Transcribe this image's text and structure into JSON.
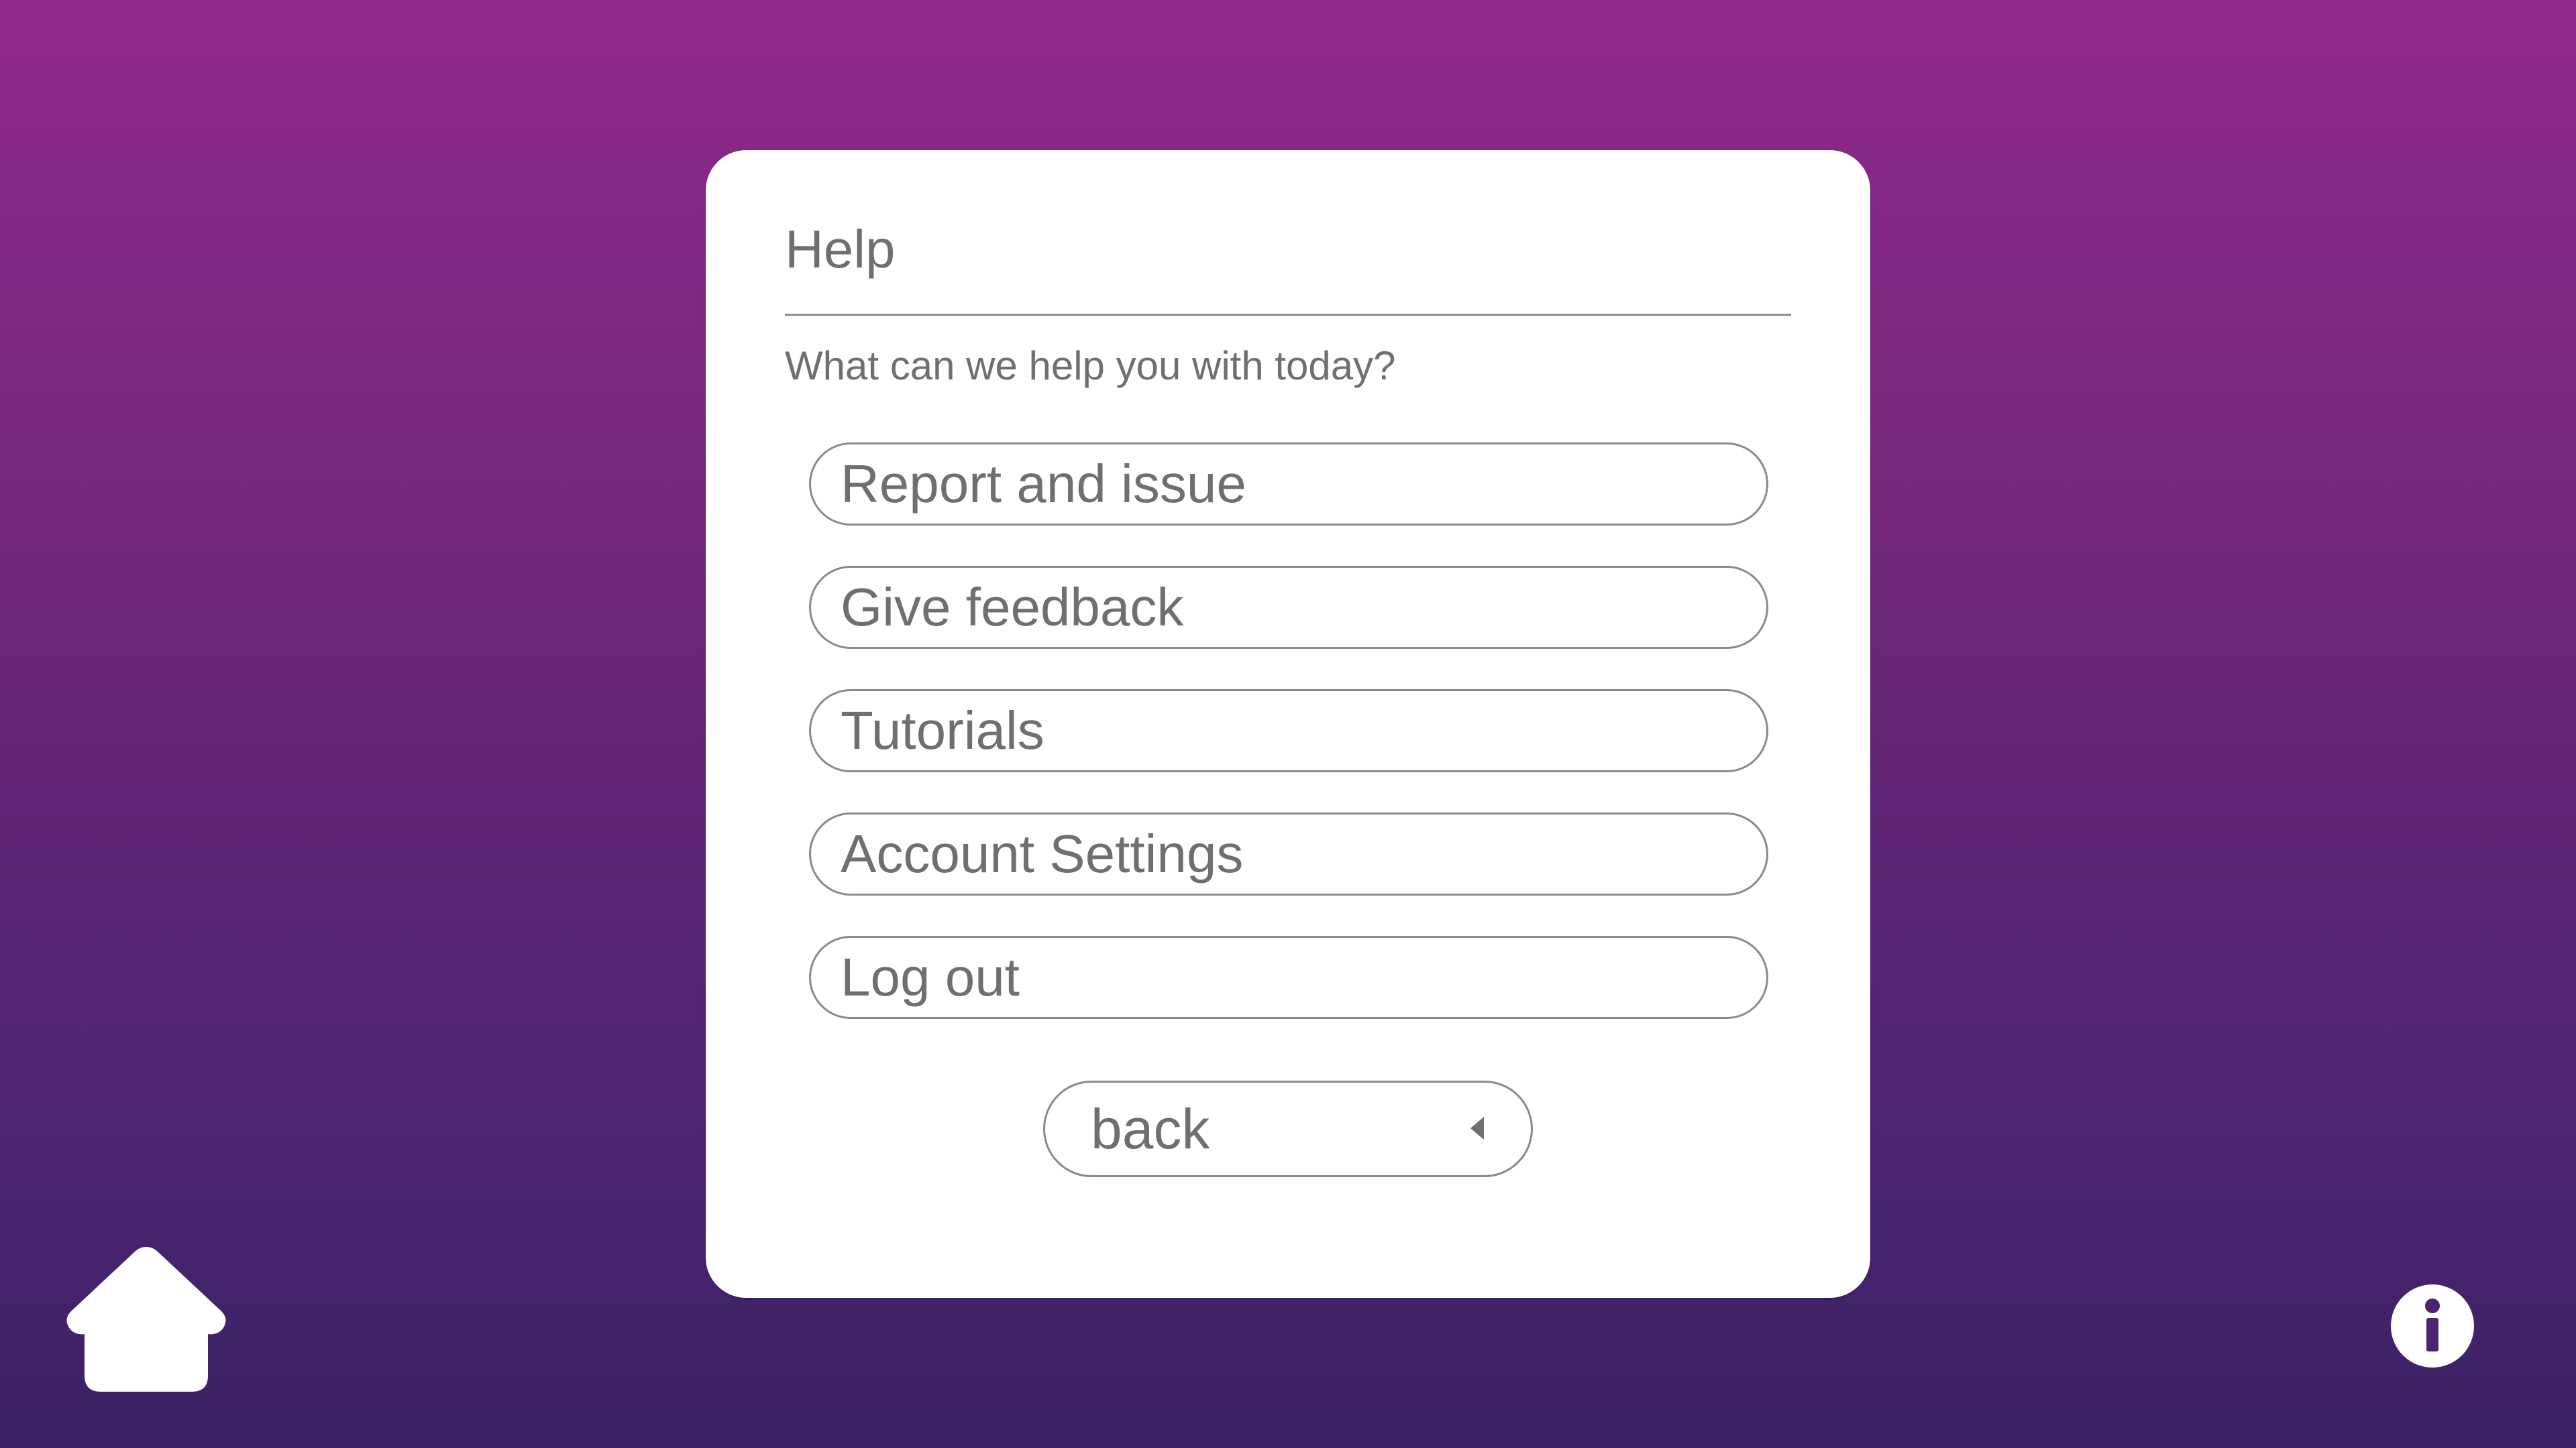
{
  "dialog": {
    "title": "Help",
    "subtitle": "What can we help you with today?",
    "options": [
      {
        "label": "Report and issue"
      },
      {
        "label": "Give feedback"
      },
      {
        "label": "Tutorials"
      },
      {
        "label": "Account Settings"
      },
      {
        "label": "Log out"
      }
    ],
    "back_label": "back"
  },
  "icons": {
    "home": "home-icon",
    "info": "info-icon",
    "back": "caret-left-icon"
  },
  "colors": {
    "background_top": "#902a8c",
    "background_bottom": "#3b2266",
    "text": "#6f6f6f",
    "border": "#8a8a8a",
    "dialog": "#ffffff"
  }
}
